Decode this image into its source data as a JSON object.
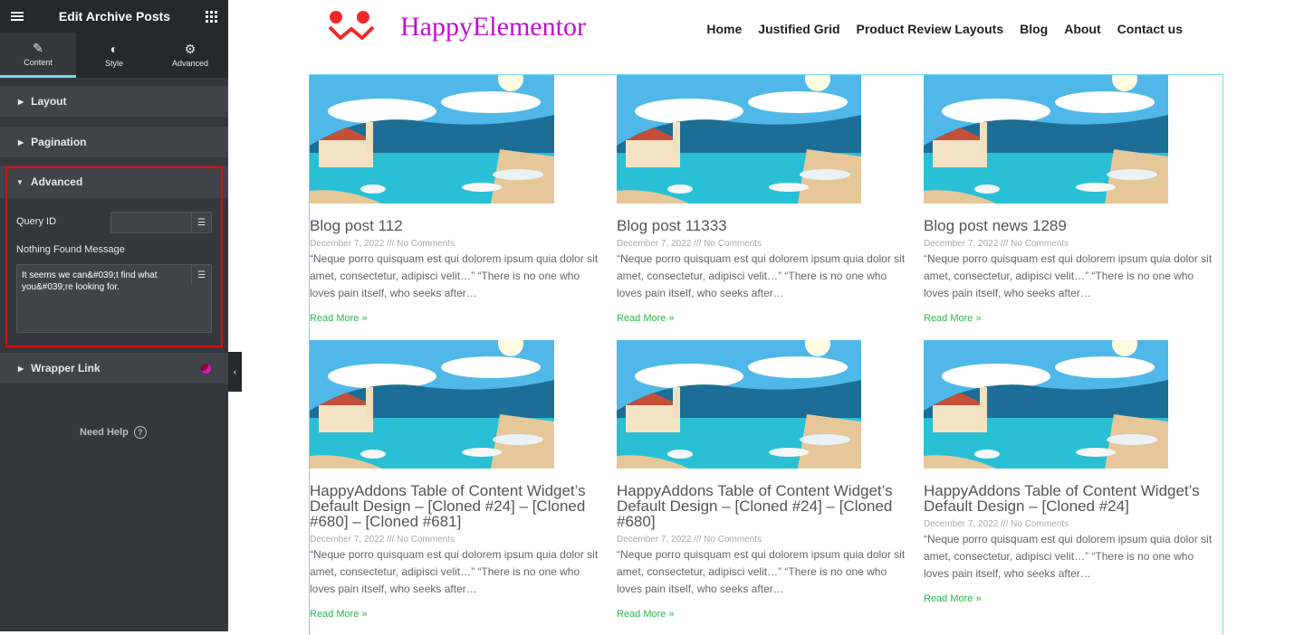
{
  "panel": {
    "title": "Edit Archive Posts",
    "tabs": [
      {
        "label": "Content",
        "icon": "pencil-icon"
      },
      {
        "label": "Style",
        "icon": "contrast-icon"
      },
      {
        "label": "Advanced",
        "icon": "gear-icon"
      }
    ],
    "sections": {
      "layout": "Layout",
      "pagination": "Pagination",
      "advanced": "Advanced",
      "wrapper_link": "Wrapper Link"
    },
    "query_id_label": "Query ID",
    "query_id_value": "",
    "nothing_found_label": "Nothing Found Message",
    "nothing_found_value": "It seems we can&#039;t find what you&#039;re looking for.",
    "need_help": "Need Help"
  },
  "site": {
    "brand": "HappyElementor",
    "nav": [
      "Home",
      "Justified Grid",
      "Product Review Layouts",
      "Blog",
      "About",
      "Contact us"
    ],
    "posts": [
      {
        "title": "Blog post 112",
        "meta": "December 7, 2022 /// No Comments",
        "excerpt": "“Neque porro quisquam est qui dolorem ipsum quia dolor sit amet, consectetur, adipisci velit…” “There is no one who loves pain itself, who seeks after…",
        "more": "Read More »"
      },
      {
        "title": "Blog post 11333",
        "meta": "December 7, 2022 /// No Comments",
        "excerpt": "“Neque porro quisquam est qui dolorem ipsum quia dolor sit amet, consectetur, adipisci velit…” “There is no one who loves pain itself, who seeks after…",
        "more": "Read More »"
      },
      {
        "title": "Blog post news 1289",
        "meta": "December 7, 2022 /// No Comments",
        "excerpt": "“Neque porro quisquam est qui dolorem ipsum quia dolor sit amet, consectetur, adipisci velit…” “There is no one who loves pain itself, who seeks after…",
        "more": "Read More »"
      },
      {
        "title": "HappyAddons Table of Content Widget’s Default Design – [Cloned #24] – [Cloned #680] – [Cloned #681]",
        "meta": "December 7, 2022 /// No Comments",
        "excerpt": "“Neque porro quisquam est qui dolorem ipsum quia dolor sit amet, consectetur, adipisci velit…” “There is no one who loves pain itself, who seeks after…",
        "more": "Read More »"
      },
      {
        "title": "HappyAddons Table of Content Widget’s Default Design – [Cloned #24] – [Cloned #680]",
        "meta": "December 7, 2022 /// No Comments",
        "excerpt": "“Neque porro quisquam est qui dolorem ipsum quia dolor sit amet, consectetur, adipisci velit…” “There is no one who loves pain itself, who seeks after…",
        "more": "Read More »"
      },
      {
        "title": "HappyAddons Table of Content Widget’s Default Design – [Cloned #24]",
        "meta": "December 7, 2022 /// No Comments",
        "excerpt": "“Neque porro quisquam est qui dolorem ipsum quia dolor sit amet, consectetur, adipisci velit…” “There is no one who loves pain itself, who seeks after…",
        "more": "Read More »"
      }
    ]
  },
  "colors": {
    "accent": "#71d7f7",
    "highlight": "#ee0000",
    "link": "#2db84c",
    "brand": "#c010d0"
  }
}
